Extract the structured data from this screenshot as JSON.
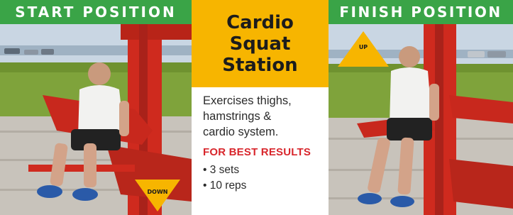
{
  "left_panel": {
    "banner": "START POSITION",
    "arrow_label": "DOWN"
  },
  "right_panel": {
    "banner": "FINISH POSITION",
    "arrow_label": "UP"
  },
  "center_panel": {
    "title_lines": [
      "Cardio",
      "Squat",
      "Station"
    ],
    "description_lines": [
      "Exercises thighs,",
      "hamstrings &",
      "cardio system."
    ],
    "best_results": "FOR BEST RESULTS",
    "recommendations": [
      "• 3 sets",
      "• 10 reps"
    ]
  },
  "colors": {
    "banner_green": "#3aa447",
    "title_yellow": "#f7b500",
    "accent_red": "#d8262c",
    "equipment_red": "#cf2a1e",
    "arrow_yellow": "#f7b500"
  }
}
